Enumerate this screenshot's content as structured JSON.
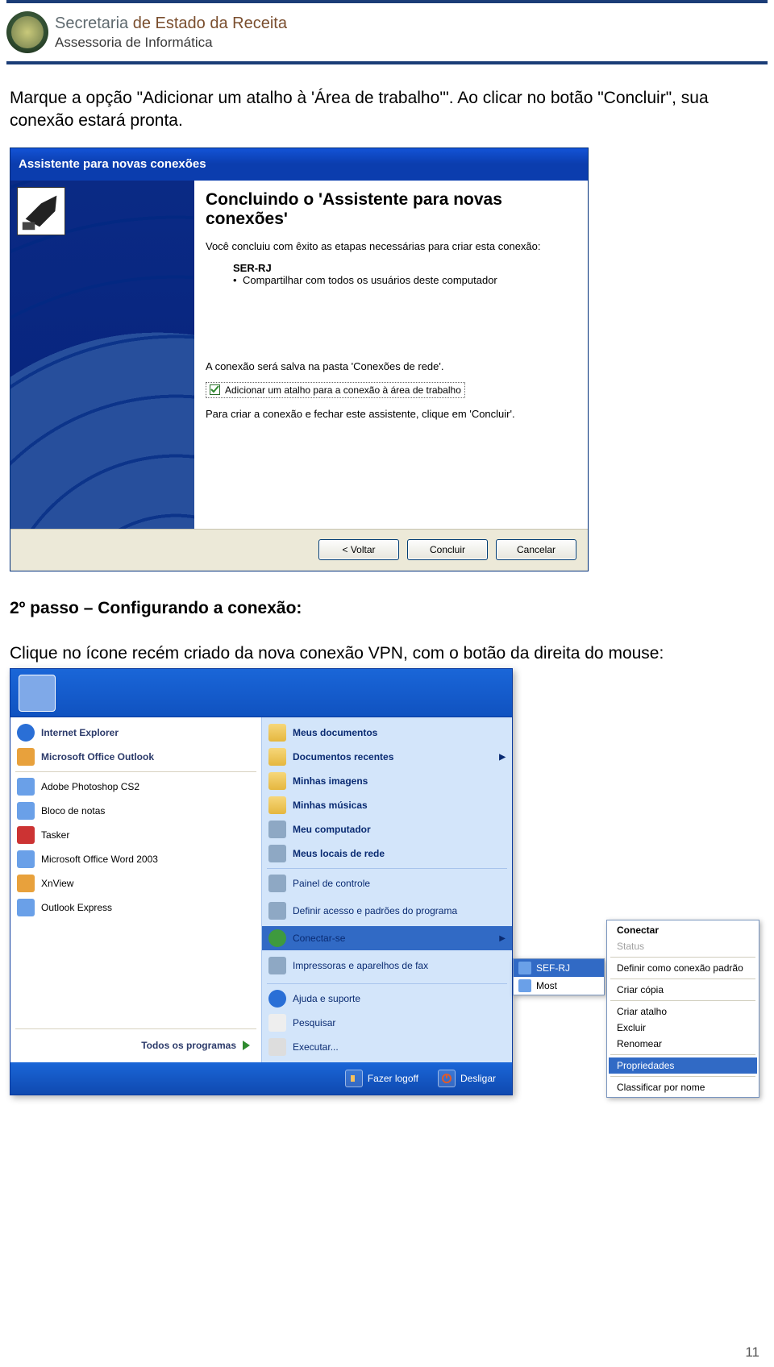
{
  "header": {
    "line1_prefix": "Secretaria ",
    "line1_suffix": "de Estado da Receita",
    "line2": "Assessoria de Informática"
  },
  "para1": "Marque a opção \"Adicionar um atalho à 'Área de trabalho'\". Ao clicar no botão \"Concluir\", sua conexão estará pronta.",
  "wizard": {
    "title": "Assistente para novas conexões",
    "heading": "Concluindo o 'Assistente para novas conexões'",
    "p1": "Você concluiu com êxito as etapas necessárias para criar esta conexão:",
    "conn_name": "SER-RJ",
    "bullet": "Compartilhar com todos os usuários deste computador",
    "p2": "A conexão será salva na pasta 'Conexões de rede'.",
    "checkbox_label": "Adicionar um atalho para a conexão à área de trabalho",
    "p3": "Para criar a conexão e fechar este assistente, clique em 'Concluir'.",
    "back": "< Voltar",
    "finish": "Concluir",
    "cancel": "Cancelar"
  },
  "step_heading": "2º passo – Configurando a conexão:",
  "para2": "Clique no ícone recém criado da nova conexão VPN, com o botão da direita do mouse:",
  "startmenu": {
    "left": [
      "Internet Explorer",
      "Microsoft Office Outlook",
      "Adobe Photoshop CS2",
      "Bloco de notas",
      "Tasker",
      "Microsoft Office Word 2003",
      "XnView",
      "Outlook Express"
    ],
    "all_programs": "Todos os programas",
    "right": [
      "Meus documentos",
      "Documentos recentes",
      "Minhas imagens",
      "Minhas músicas",
      "Meu computador",
      "Meus locais de rede",
      "Painel de controle",
      "Definir acesso e padrões do programa",
      "Conectar-se",
      "Impressoras e aparelhos de fax",
      "Ajuda e suporte",
      "Pesquisar",
      "Executar..."
    ],
    "logoff": "Fazer logoff",
    "shutdown": "Desligar"
  },
  "flyout": {
    "items": [
      "SEF-RJ",
      "Most"
    ]
  },
  "ctx": {
    "connect": "Conectar",
    "status": "Status",
    "setdefault": "Definir como conexão padrão",
    "copy": "Criar cópia",
    "shortcut": "Criar atalho",
    "delete": "Excluir",
    "rename": "Renomear",
    "properties": "Propriedades",
    "sort": "Classificar por nome"
  },
  "page_number": "11"
}
